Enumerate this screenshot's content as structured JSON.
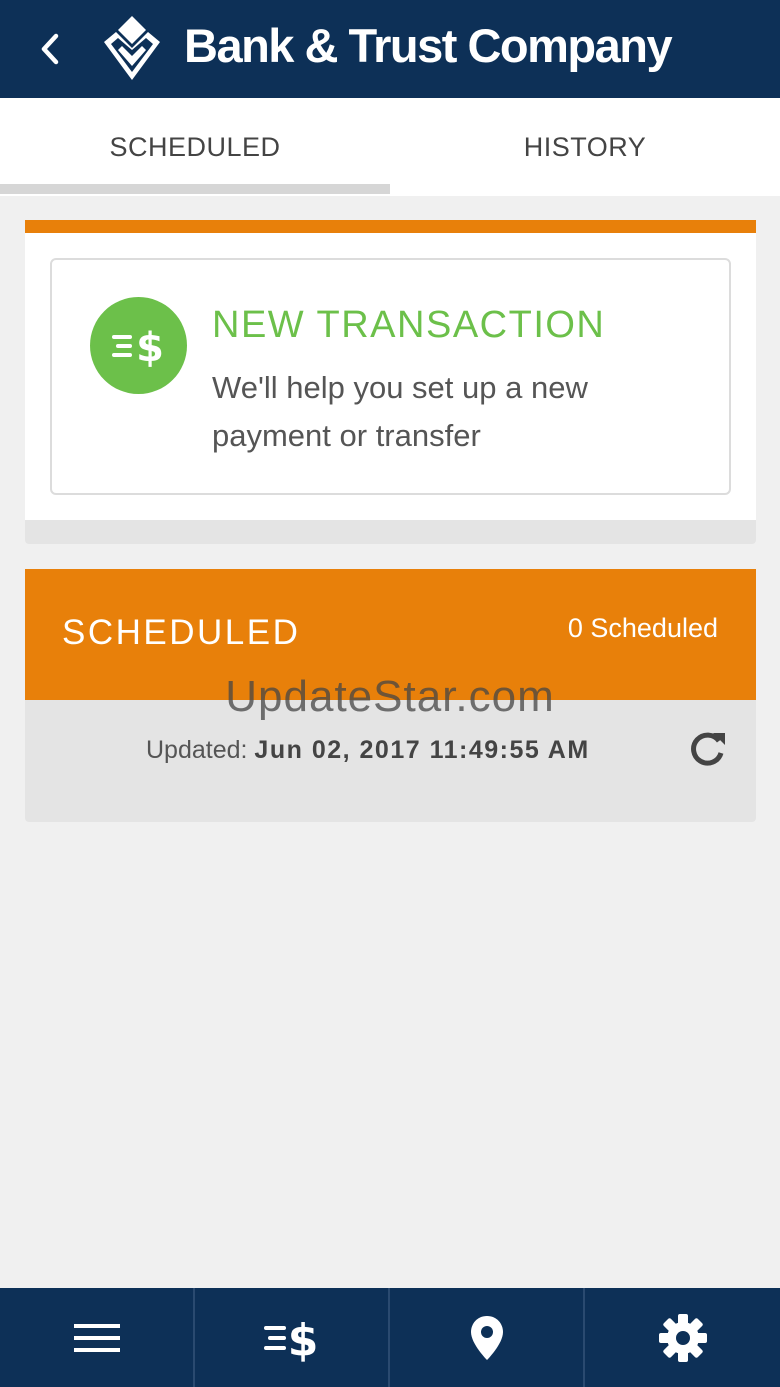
{
  "header": {
    "back_icon": "chevron-left-icon",
    "logo_icon": "diamond-logo-icon",
    "brand_name": "Bank & Trust Company"
  },
  "tabs": [
    {
      "label": "SCHEDULED",
      "active": true
    },
    {
      "label": "HISTORY",
      "active": false
    }
  ],
  "new_transaction": {
    "icon": "transfer-dollar-icon",
    "title": "NEW TRANSACTION",
    "description": "We'll help you set up a new payment or transfer"
  },
  "scheduled": {
    "title": "SCHEDULED",
    "count_text": "0 Scheduled",
    "updated_label": "Updated:",
    "updated_value": "Jun 02, 2017 11:49:55 AM",
    "refresh_icon": "refresh-icon"
  },
  "watermark": "UpdateStar.com",
  "bottom_nav": [
    {
      "icon": "menu-icon"
    },
    {
      "icon": "transfer-dollar-icon"
    },
    {
      "icon": "location-pin-icon"
    },
    {
      "icon": "gear-icon"
    }
  ],
  "colors": {
    "brand_navy": "#0d3057",
    "accent_orange": "#e8800a",
    "accent_green": "#6cc04a",
    "background": "#f0f0f0"
  }
}
